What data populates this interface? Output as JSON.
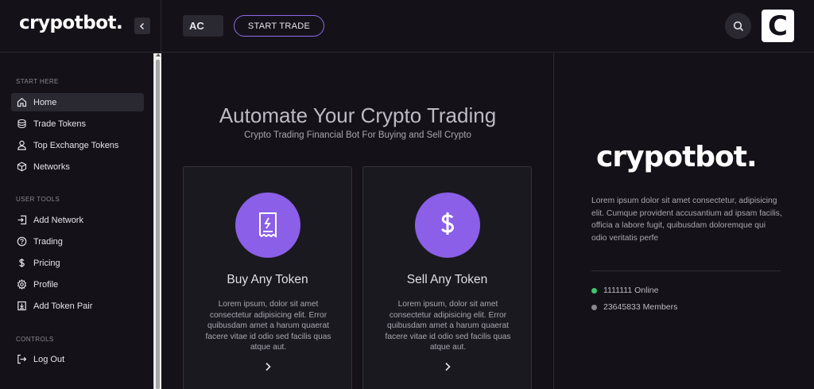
{
  "header": {
    "logo": "crypotbot.",
    "account_code": "AC",
    "start_trade_label": "START TRADE",
    "avatar_letter": "C"
  },
  "sidebar": {
    "sections": [
      {
        "label": "START HERE",
        "items": [
          {
            "label": "Home",
            "icon": "home-icon",
            "active": true
          },
          {
            "label": "Trade Tokens",
            "icon": "coins-icon"
          },
          {
            "label": "Top Exchange Tokens",
            "icon": "user-icon"
          },
          {
            "label": "Networks",
            "icon": "cube-icon"
          }
        ]
      },
      {
        "label": "USER TOOLS",
        "items": [
          {
            "label": "Add Network",
            "icon": "arrow-right-box-icon"
          },
          {
            "label": "Trading",
            "icon": "help-circle-icon"
          },
          {
            "label": "Pricing",
            "icon": "dollar-icon"
          },
          {
            "label": "Profile",
            "icon": "gear-icon"
          },
          {
            "label": "Add Token Pair",
            "icon": "download-box-icon"
          }
        ]
      },
      {
        "label": "CONTROLS",
        "items": [
          {
            "label": "Log Out",
            "icon": "logout-icon"
          }
        ]
      }
    ]
  },
  "main": {
    "title": "Automate Your Crypto Trading",
    "subtitle": "Crypto Trading Financial Bot For Buying and Sell Crypto",
    "cards": [
      {
        "title": "Buy Any Token",
        "icon": "receipt-icon",
        "text": "Lorem ipsum, dolor sit amet consectetur adipisicing elit. Error quibusdam amet a harum quaerat facere vitae id odio sed facilis quas atque aut."
      },
      {
        "title": "Sell Any Token",
        "icon": "dollar-icon",
        "text": "Lorem ipsum, dolor sit amet consectetur adipisicing elit. Error quibusdam amet a harum quaerat facere vitae id odio sed facilis quas atque aut."
      }
    ]
  },
  "right_panel": {
    "logo": "crypotbot.",
    "text": "Lorem ipsum dolor sit amet consectetur, adipisicing elit. Cumque provident accusantium ad ipsam facilis, officia a labore fugit, quibusdam doloremque qui odio veritatis perfe",
    "stats": [
      {
        "label": "1111111 Online",
        "color": "#3fc66a"
      },
      {
        "label": "23645833 Members",
        "color": "#8a8790"
      }
    ]
  },
  "colors": {
    "accent": "#8b5fe8",
    "background": "#141218",
    "card": "#1b1920"
  }
}
